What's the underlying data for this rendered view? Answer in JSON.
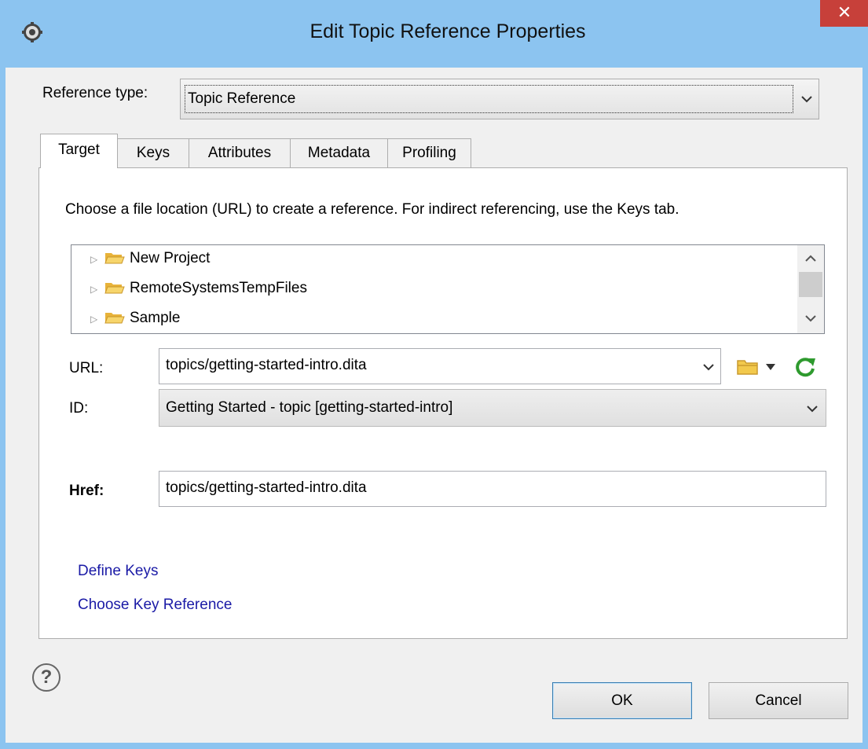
{
  "window": {
    "title": "Edit Topic Reference Properties",
    "close_glyph": "✕"
  },
  "reference_type": {
    "label": "Reference type:",
    "value": "Topic Reference"
  },
  "tabs": [
    {
      "label": "Target",
      "active": true
    },
    {
      "label": "Keys",
      "active": false
    },
    {
      "label": "Attributes",
      "active": false
    },
    {
      "label": "Metadata",
      "active": false
    },
    {
      "label": "Profiling",
      "active": false
    }
  ],
  "target": {
    "instructions": "Choose a file location (URL) to create a reference. For indirect referencing, use the Keys tab.",
    "tree_items": [
      "New Project",
      "RemoteSystemsTempFiles",
      "Sample"
    ],
    "url": {
      "label": "URL:",
      "value": "topics/getting-started-intro.dita"
    },
    "id": {
      "label": "ID:",
      "value": "Getting Started - topic [getting-started-intro]"
    },
    "href": {
      "label": "Href:",
      "value": "topics/getting-started-intro.dita"
    },
    "links": {
      "define_keys": "Define Keys",
      "choose_key_reference": "Choose Key Reference"
    }
  },
  "buttons": {
    "ok": "OK",
    "cancel": "Cancel",
    "help": "?"
  },
  "icons": {
    "app": "gear-icon",
    "tree_folder": "folder-icon",
    "browse": "folder-icon",
    "refresh": "refresh-icon",
    "expand": "chevron-right-icon",
    "dropdown": "chevron-down-icon"
  },
  "colors": {
    "titlebar": "#8cc4f0",
    "close": "#c7403a",
    "link": "#1a1aa6",
    "refresh": "#2e9a2e",
    "folder": "#f2c94c"
  }
}
